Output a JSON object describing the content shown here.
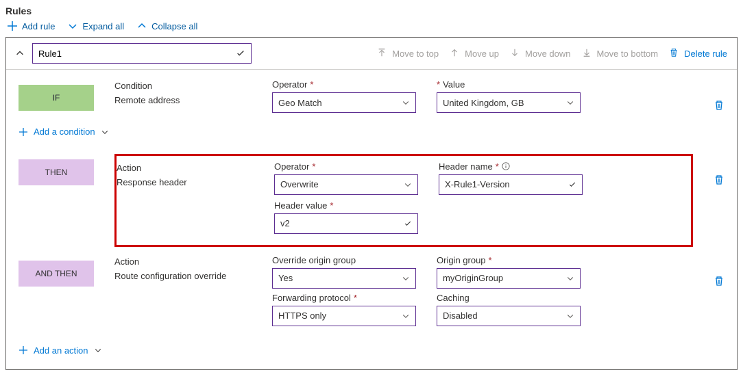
{
  "header": {
    "title": "Rules",
    "add_rule": "Add rule",
    "expand_all": "Expand all",
    "collapse_all": "Collapse all"
  },
  "rule": {
    "name": "Rule1",
    "move_to_top": "Move to top",
    "move_up": "Move up",
    "move_down": "Move down",
    "move_to_bottom": "Move to bottom",
    "delete_rule": "Delete rule"
  },
  "condition": {
    "label_top": "Condition",
    "label_sub": "Remote address",
    "operator_label": "Operator",
    "operator_value": "Geo Match",
    "value_label": "Value",
    "value_value": "United Kingdom, GB"
  },
  "add_condition": "Add a condition",
  "action1": {
    "label_top": "Action",
    "label_sub": "Response header",
    "operator_label": "Operator",
    "operator_value": "Overwrite",
    "header_name_label": "Header name",
    "header_name_value": "X-Rule1-Version",
    "header_value_label": "Header value",
    "header_value_value": "v2"
  },
  "action2": {
    "label_top": "Action",
    "label_sub": "Route configuration override",
    "override_label": "Override origin group",
    "override_value": "Yes",
    "origin_group_label": "Origin group",
    "origin_group_value": "myOriginGroup",
    "fwd_label": "Forwarding protocol",
    "fwd_value": "HTTPS only",
    "cache_label": "Caching",
    "cache_value": "Disabled"
  },
  "add_action": "Add an action",
  "badges": {
    "if": "IF",
    "then": "THEN",
    "and_then": "AND THEN"
  }
}
